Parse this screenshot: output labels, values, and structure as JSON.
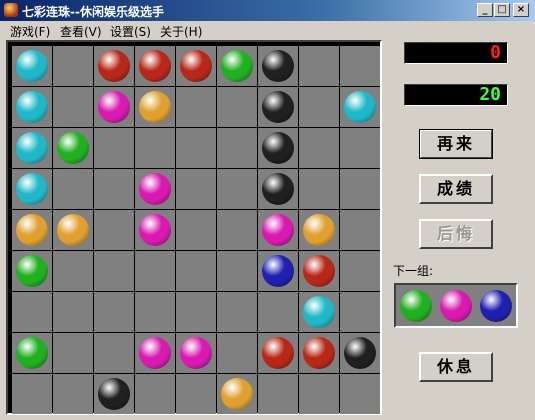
{
  "window": {
    "title": "七彩连珠--休闲娱乐级选手",
    "controls": [
      "_",
      "□",
      "×"
    ]
  },
  "menu": [
    "游戏(F)",
    "查看(V)",
    "设置(S)",
    "关于(H)"
  ],
  "scores": {
    "current": "0",
    "high": "20",
    "current_color": "#ff2020",
    "high_color": "#40ff40"
  },
  "buttons": {
    "restart": "再来",
    "scores": "成绩",
    "undo": "后悔",
    "rest": "休息"
  },
  "next": {
    "label": "下一组:",
    "balls": [
      "green",
      "magenta",
      "blue"
    ]
  },
  "colors": {
    "cyan": "#20b8c8",
    "red": "#b82818",
    "green": "#20b020",
    "black": "#202020",
    "magenta": "#d81ab0",
    "orange": "#e0a030",
    "blue": "#2020b0"
  },
  "board": [
    [
      "cyan",
      "",
      "red",
      "red",
      "red",
      "green",
      "black",
      "",
      ""
    ],
    [
      "cyan",
      "",
      "magenta",
      "orange",
      "",
      "",
      "black",
      "",
      "cyan"
    ],
    [
      "cyan",
      "green",
      "",
      "",
      "",
      "",
      "black",
      "",
      ""
    ],
    [
      "cyan",
      "",
      "",
      "magenta",
      "",
      "",
      "black",
      "",
      ""
    ],
    [
      "orange",
      "orange",
      "",
      "magenta",
      "",
      "",
      "magenta",
      "orange",
      ""
    ],
    [
      "green",
      "",
      "",
      "",
      "",
      "",
      "blue",
      "red",
      ""
    ],
    [
      "",
      "",
      "",
      "",
      "",
      "",
      "",
      "cyan",
      ""
    ],
    [
      "green",
      "",
      "",
      "magenta",
      "magenta",
      "",
      "red",
      "red",
      "black"
    ],
    [
      "",
      "",
      "black",
      "",
      "",
      "orange",
      "",
      "",
      ""
    ]
  ]
}
